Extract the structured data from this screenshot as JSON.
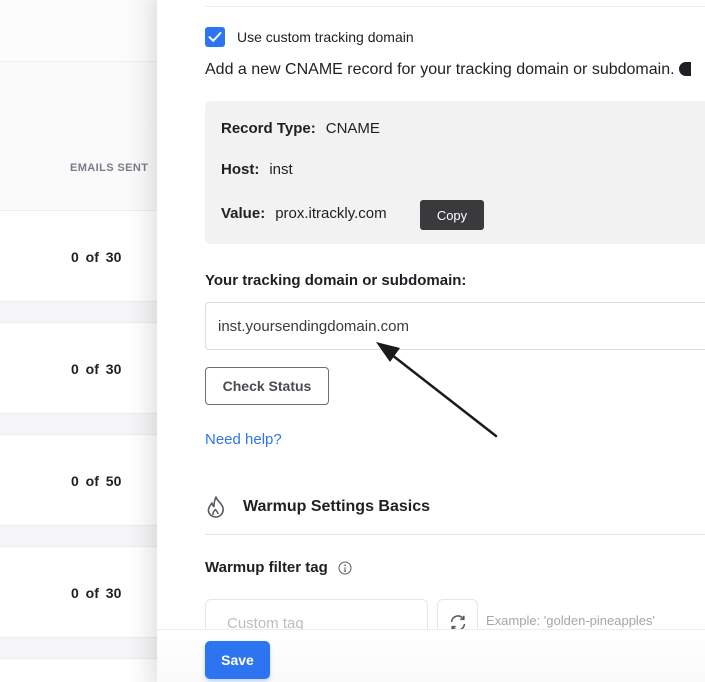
{
  "background_table": {
    "column_header": "EMAILS SENT",
    "rows": [
      {
        "emails_sent": "0 of 30"
      },
      {
        "emails_sent": "0 of 30"
      },
      {
        "emails_sent": "0 of 50"
      },
      {
        "emails_sent": "0 of 30"
      }
    ]
  },
  "tracking": {
    "checkbox_label": "Use custom tracking domain",
    "checkbox_checked": true,
    "instruction": "Add a new CNAME record for your tracking domain or subdomain.",
    "record": {
      "type_label": "Record Type:",
      "type_value": "CNAME",
      "host_label": "Host:",
      "host_value": "inst",
      "value_label": "Value:",
      "value_value": "prox.itrackly.com",
      "copy_label": "Copy"
    },
    "domain_field_label": "Your tracking domain or subdomain:",
    "domain_field_value": "inst.yoursendingdomain.com",
    "check_status_label": "Check Status",
    "need_help_label": "Need help?"
  },
  "warmup": {
    "section_title": "Warmup Settings Basics",
    "filter_tag_label": "Warmup filter tag",
    "custom_tag_placeholder": "Custom tag",
    "example_text": "Example: 'golden-pineapples'"
  },
  "footer": {
    "save_label": "Save"
  },
  "colors": {
    "accent": "#2d75f0",
    "copy_button": "#3a3a3c",
    "record_box": "#f2f2f3"
  },
  "icons": {
    "checkbox": "checkmark-icon",
    "section": "flame-icon",
    "info": "info-icon",
    "refresh": "refresh-icon",
    "annotation": "arrow-icon"
  }
}
